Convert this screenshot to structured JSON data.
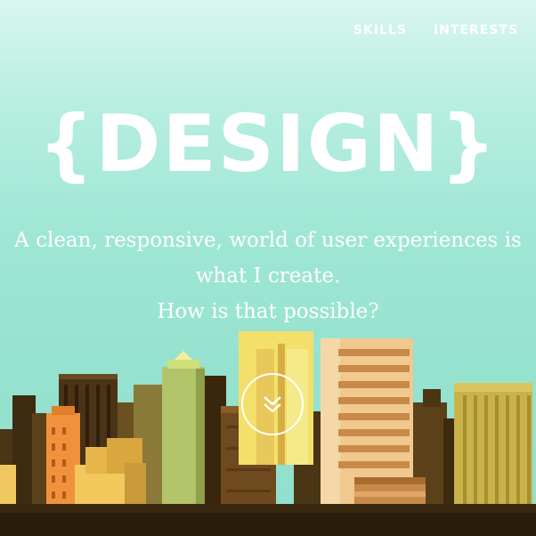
{
  "nav": {
    "items": [
      {
        "label": "SKILLS"
      },
      {
        "label": "INTERESTS"
      }
    ]
  },
  "hero": {
    "title": "{DESIGN}",
    "tagline_line1": "A clean, responsive, world of user experiences is",
    "tagline_line2": "what I create.",
    "tagline_line3": "How is that possible?"
  },
  "scroll_button": {
    "icon": "double-chevron-down-icon"
  },
  "colors": {
    "sky_top": "#d9f6ef",
    "sky_bottom": "#90dfcc",
    "text": "#ffffff",
    "ground": "#2a1d0c"
  }
}
